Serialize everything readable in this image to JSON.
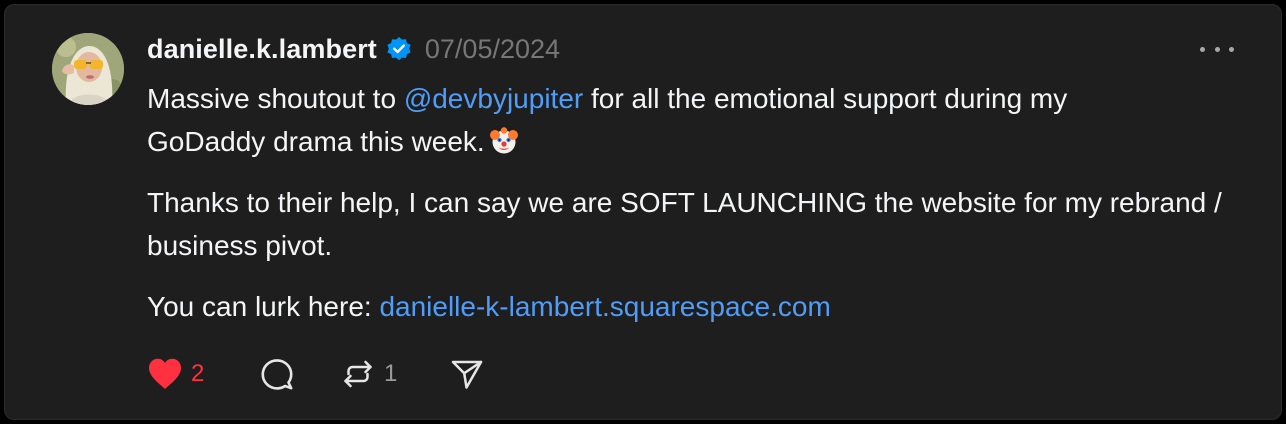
{
  "post": {
    "username": "danielle.k.lambert",
    "date": "07/05/2024",
    "paragraph1": {
      "before": "Massive shoutout to ",
      "mention": "@devbyjupiter",
      "after_line1": " for all the emotional support during my",
      "line2": "GoDaddy drama this week."
    },
    "paragraph2": "Thanks to their help, I can say we are SOFT LAUNCHING the website for my rebrand / business pivot.",
    "paragraph3": {
      "before": "You can lurk here: ",
      "link": "danielle-k-lambert.squarespace.com"
    },
    "emoji": "clown-face-icon",
    "actions": {
      "like_count": "2",
      "repost_count": "1"
    }
  },
  "colors": {
    "background": "#1e1e1e",
    "text": "#f3f5f7",
    "muted": "#777777",
    "link": "#4f9df8",
    "like": "#ff3040",
    "verified": "#0095f6"
  }
}
